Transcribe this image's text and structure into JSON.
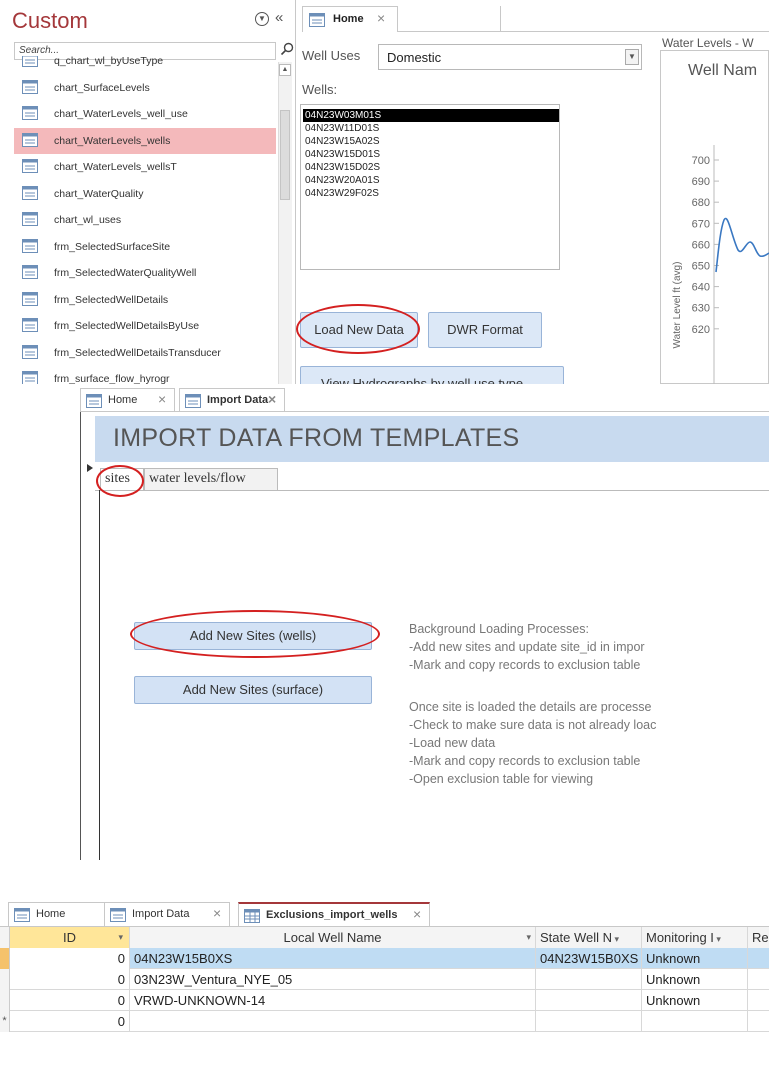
{
  "nav": {
    "title": "Custom",
    "search_placeholder": "Search...",
    "items": [
      "q_chart_wl_byUseType",
      "chart_SurfaceLevels",
      "chart_WaterLevels_well_use",
      "chart_WaterLevels_wells",
      "chart_WaterLevels_wellsT",
      "chart_WaterQuality",
      "chart_wl_uses",
      "frm_SelectedSurfaceSite",
      "frm_SelectedWaterQualityWell",
      "frm_SelectedWellDetails",
      "frm_SelectedWellDetailsByUse",
      "frm_SelectedWellDetailsTransducer",
      "frm_surface_flow_hyrogr"
    ],
    "selected_index": 3
  },
  "home": {
    "tab_label": "Home",
    "well_uses_label": "Well Uses",
    "well_uses_value": "Domestic",
    "wells_label": "Wells:",
    "wells": [
      "04N23W03M01S",
      "04N23W11D01S",
      "04N23W15A02S",
      "04N23W15D01S",
      "04N23W15D02S",
      "04N23W20A01S",
      "04N23W29F02S"
    ],
    "wells_selected_index": 0,
    "load_button": "Load New Data",
    "dwr_button": "DWR Format",
    "hydrograph_button": "View Hydrographs by well use type",
    "chart_header": "Water Levels - W",
    "chart_title": "Well Nam",
    "chart_ylabel": "Water Level ft (avg)",
    "chart_yticks": [
      "700",
      "690",
      "680",
      "670",
      "660",
      "650",
      "640",
      "630",
      "620"
    ]
  },
  "import": {
    "tabs": [
      "Home",
      "Import Data"
    ],
    "header": "IMPORT DATA FROM TEMPLATES",
    "subtabs": [
      "sites",
      "water levels/flow"
    ],
    "add_wells_button": "Add New Sites (wells)",
    "add_surface_button": "Add New Sites (surface)",
    "notes_a": [
      "Background Loading Processes:",
      "-Add new sites and update site_id in impor",
      "-Mark and copy records to exclusion table"
    ],
    "notes_b": [
      "Once site is loaded the details are processe",
      "-Check to make sure data is not already loac",
      "-Load new data",
      "-Mark and copy records to exclusion table",
      "-Open exclusion table for viewing"
    ]
  },
  "exclusions": {
    "tabs": [
      "Home",
      "Import Data",
      "Exclusions_import_wells"
    ],
    "columns": [
      "ID",
      "Local Well Name",
      "State Well N",
      "Monitoring I",
      "Re"
    ],
    "rows": [
      {
        "id": "0",
        "local": "04N23W15B0XS",
        "state": "04N23W15B0XS",
        "mon": "Unknown"
      },
      {
        "id": "0",
        "local": "03N23W_Ventura_NYE_05",
        "state": "",
        "mon": "Unknown"
      },
      {
        "id": "0",
        "local": "VRWD-UNKNOWN-14",
        "state": "",
        "mon": "Unknown"
      },
      {
        "id": "0",
        "local": "",
        "state": "",
        "mon": ""
      }
    ],
    "new_row_marker": "*"
  },
  "colors": {
    "accent": "#a4373a",
    "selected_nav": "#f4b9bb",
    "annotation": "#d42020",
    "header_band": "#c8daef",
    "row_active": "#bfdcf3"
  }
}
